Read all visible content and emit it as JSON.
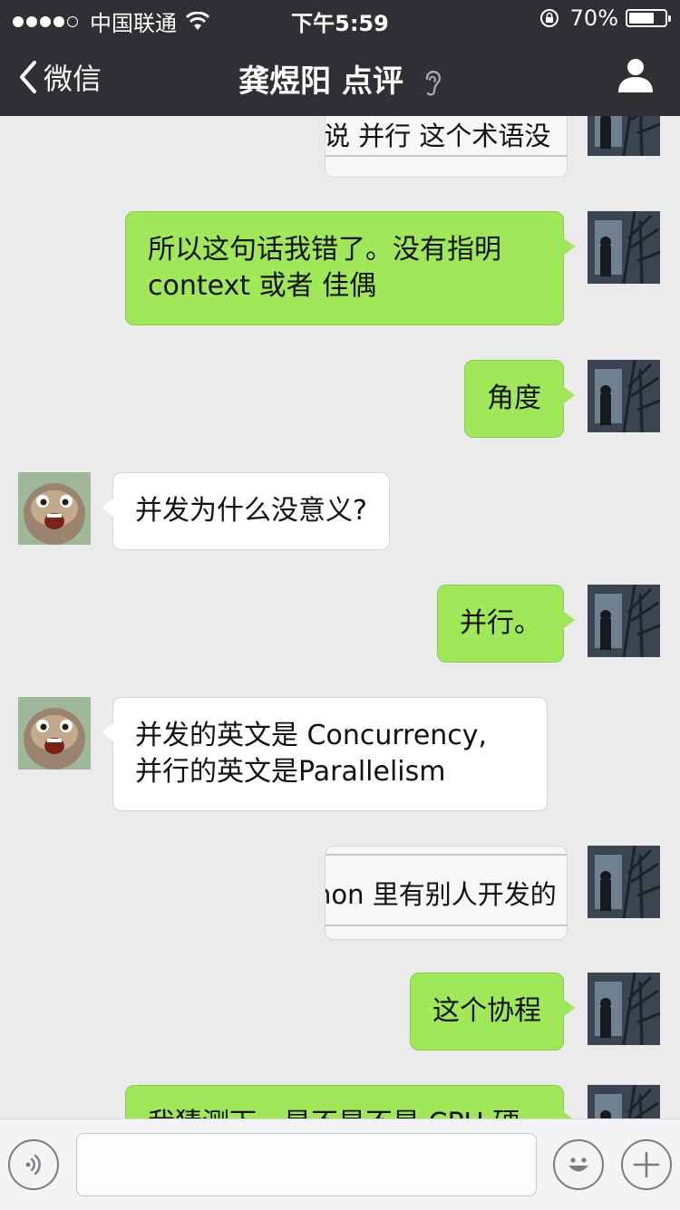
{
  "status_bar": {
    "carrier": "中国联通",
    "signal_bars_filled": 4,
    "signal_bars_total": 5,
    "time": "下午5:59",
    "battery_percent": "70%",
    "battery_level": 0.7
  },
  "nav": {
    "back_label": "微信",
    "title": "龚煜阳 点评"
  },
  "messages": [
    {
      "from": "me",
      "kind": "image",
      "visible_text": "说 并行 这个术语没"
    },
    {
      "from": "me",
      "kind": "text",
      "lines": [
        "所以这句话我错了。没有指明",
        "context 或者 佳偶"
      ]
    },
    {
      "from": "me",
      "kind": "text",
      "lines": [
        "角度"
      ]
    },
    {
      "from": "them",
      "kind": "text",
      "lines": [
        "并发为什么没意义?"
      ]
    },
    {
      "from": "me",
      "kind": "text",
      "lines": [
        "并行。"
      ]
    },
    {
      "from": "them",
      "kind": "text",
      "lines": [
        "并发的英文是 Concurrency,",
        "并行的英文是Parallelism"
      ]
    },
    {
      "from": "me",
      "kind": "image",
      "visible_text": "hon 里有别人开发的"
    },
    {
      "from": "me",
      "kind": "text",
      "lines": [
        "这个协程"
      ]
    },
    {
      "from": "me",
      "kind": "text",
      "lines": [
        "我猜测下，是不是不是 CPU 硬"
      ]
    }
  ],
  "colors": {
    "header_bg": "#2e3033",
    "chat_bg": "#ebebeb",
    "my_bubble": "#a0e759",
    "their_bubble": "#ffffff"
  },
  "icons": {
    "back": "chevron-left-icon",
    "ear": "ear-icon",
    "profile": "person-icon",
    "voice": "voice-icon",
    "emoji": "emoji-icon",
    "more": "plus-icon"
  }
}
